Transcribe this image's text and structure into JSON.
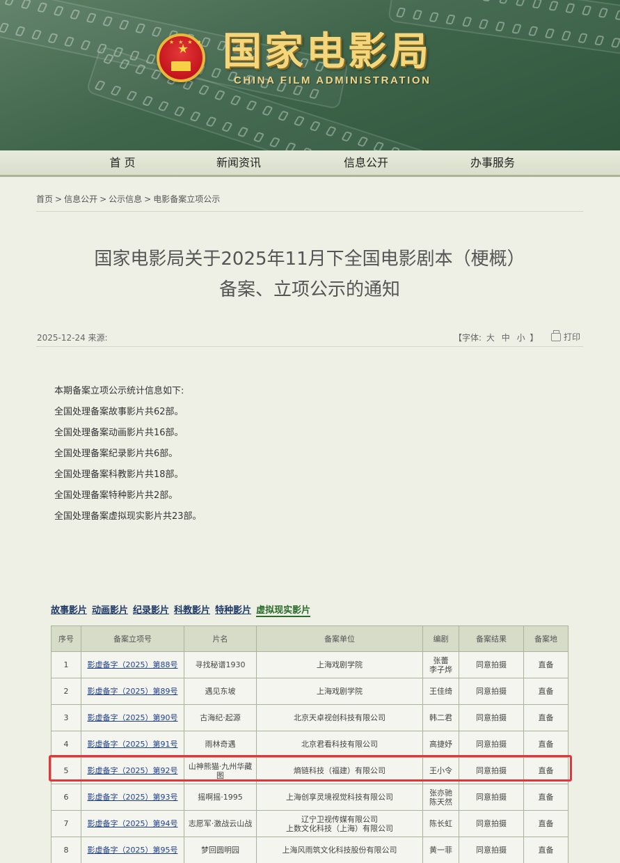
{
  "header": {
    "title": "国家电影局",
    "subtitle": "CHINA FILM ADMINISTRATION",
    "emblem_icon": "national-emblem-icon"
  },
  "nav": {
    "items": [
      {
        "label": "首 页"
      },
      {
        "label": "新闻资讯"
      },
      {
        "label": "信息公开"
      },
      {
        "label": "办事服务"
      }
    ]
  },
  "breadcrumb": {
    "items": [
      "首页",
      "信息公开",
      "公示信息",
      "电影备案立项公示"
    ],
    "separator": ">"
  },
  "article": {
    "title_line1": "国家电影局关于2025年11月下全国电影剧本（梗概）",
    "title_line2": "备案、立项公示的通知",
    "date_source": "2025-12-24 来源:",
    "font_size_label": "【字体:",
    "font_sizes": [
      "大",
      "中",
      "小"
    ],
    "font_size_end": "】",
    "print_label": "打印",
    "print_icon": "printer-icon"
  },
  "stats": {
    "intro": "本期备案立项公示统计信息如下:",
    "lines": [
      "全国处理备案故事影片共62部。",
      "全国处理备案动画影片共16部。",
      "全国处理备案纪录影片共6部。",
      "全国处理备案科教影片共18部。",
      "全国处理备案特种影片共2部。",
      "全国处理备案虚拟现实影片共23部。"
    ]
  },
  "tabs": {
    "items": [
      "故事影片",
      "动画影片",
      "纪录影片",
      "科教影片",
      "特种影片",
      "虚拟现实影片"
    ],
    "active": "虚拟现实影片"
  },
  "table": {
    "headers": [
      "序号",
      "备案立项号",
      "片名",
      "备案单位",
      "编剧",
      "备案结果",
      "备案地"
    ],
    "rows": [
      {
        "no": "1",
        "id": "影虚备字（2025）第88号",
        "name": "寻找秘谱1930",
        "unit": "上海戏剧学院",
        "writer": "张蕾\n李子烨",
        "result": "同意拍摄",
        "place": "直备"
      },
      {
        "no": "2",
        "id": "影虚备字（2025）第89号",
        "name": "遇见东坡",
        "unit": "上海戏剧学院",
        "writer": "王佳绮",
        "result": "同意拍摄",
        "place": "直备"
      },
      {
        "no": "3",
        "id": "影虚备字（2025）第90号",
        "name": "古海纪·起源",
        "unit": "北京天卓视创科技有限公司",
        "writer": "韩二君",
        "result": "同意拍摄",
        "place": "直备"
      },
      {
        "no": "4",
        "id": "影虚备字（2025）第91号",
        "name": "雨林奇遇",
        "unit": "北京君看科技有限公司",
        "writer": "高捷妤",
        "result": "同意拍摄",
        "place": "直备"
      },
      {
        "no": "5",
        "id": "影虚备字（2025）第92号",
        "name": "山神熊猫·九州华藏图",
        "unit": "熵链科技（福建）有限公司",
        "writer": "王小令",
        "result": "同意拍摄",
        "place": "直备"
      },
      {
        "no": "6",
        "id": "影虚备字（2025）第93号",
        "name": "摇啊摇·1995",
        "unit": "上海创享灵境视觉科技有限公司",
        "writer": "张亦驰\n陈天然",
        "result": "同意拍摄",
        "place": "直备"
      },
      {
        "no": "7",
        "id": "影虚备字（2025）第94号",
        "name": "志愿军·激战云山战",
        "unit": "辽宁卫视传媒有限公司\n上数文化科技（上海）有限公司",
        "writer": "陈长虹",
        "result": "同意拍摄",
        "place": "直备"
      },
      {
        "no": "8",
        "id": "影虚备字（2025）第95号",
        "name": "梦回圆明园",
        "unit": "上海风雨筑文化科技股份有限公司",
        "writer": "黄一菲",
        "result": "同意拍摄",
        "place": "直备"
      }
    ],
    "highlighted_row": 5
  },
  "colors": {
    "banner": "#3f654b",
    "title_gold": "#f4d67d",
    "link": "#1e3f8f",
    "highlight": "#e8333a",
    "page_bg": "#eef0e6"
  }
}
